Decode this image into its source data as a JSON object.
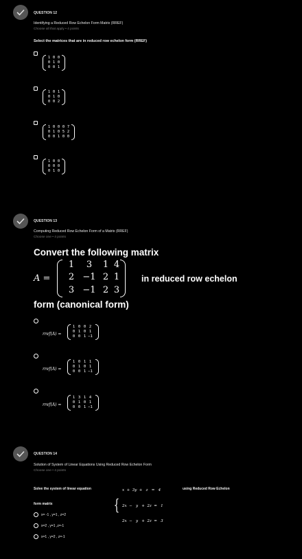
{
  "q12": {
    "number": "QUESTION 12",
    "title": "Identifying a Reduced Row Echelon Form Matrix (RREF)",
    "sub": "Choose all that apply • 4 points",
    "prompt": "Select the matrices that are in reduced row echelon form (RREF)",
    "options": [
      {
        "rows": [
          [
            "1",
            "0",
            "0"
          ],
          [
            "0",
            "1",
            "0"
          ],
          [
            "0",
            "0",
            "1"
          ]
        ]
      },
      {
        "rows": [
          [
            "1",
            "0",
            "1"
          ],
          [
            "0",
            "1",
            "0"
          ],
          [
            "0",
            "0",
            "2"
          ]
        ]
      },
      {
        "rows": [
          [
            "1",
            "0",
            "0",
            "0",
            "7"
          ],
          [
            "0",
            "1",
            "0",
            "5",
            "2"
          ],
          [
            "0",
            "0",
            "1",
            "0",
            "0"
          ]
        ]
      },
      {
        "rows": [
          [
            "1",
            "0",
            "0"
          ],
          [
            "0",
            "0",
            "0"
          ],
          [
            "0",
            "1",
            "0"
          ]
        ]
      }
    ]
  },
  "q13": {
    "number": "QUESTION 13",
    "title": "Computing Reduced Row Echelon Form of a Matrix (RREF)",
    "sub": "Choose one • 4 points",
    "prompt_line1": "Convert the following matrix",
    "a_label": "A =",
    "matrix": [
      [
        "1",
        "3",
        "1",
        "4"
      ],
      [
        "2",
        "−1",
        "2",
        "1"
      ],
      [
        "3",
        "−1",
        "2",
        "3"
      ]
    ],
    "prompt_line2": "in reduced row echelon",
    "prompt_line3": "form (canonical form)",
    "rref_label": "rref(A) =",
    "options": [
      {
        "rows": [
          [
            "1",
            "0",
            "0",
            "2"
          ],
          [
            "0",
            "1",
            "0",
            "1"
          ],
          [
            "0",
            "0",
            "1",
            "−1"
          ]
        ]
      },
      {
        "rows": [
          [
            "1",
            "0",
            "1",
            "1"
          ],
          [
            "0",
            "1",
            "0",
            "1"
          ],
          [
            "0",
            "0",
            "1",
            "−1"
          ]
        ]
      },
      {
        "rows": [
          [
            "1",
            "3",
            "1",
            "4"
          ],
          [
            "0",
            "1",
            "0",
            "1"
          ],
          [
            "0",
            "0",
            "1",
            "−1"
          ]
        ]
      }
    ]
  },
  "q14": {
    "number": "QUESTION 14",
    "title": "Solution of System of Linear Equations Using Reduced Row Echelon Form",
    "sub": "Choose one • 4 points",
    "prompt_a": "Solve the system of linear equation",
    "system": [
      "x  +  3y  +   z   =   4",
      "2x  −   y   +  2z  =   1",
      "2x  −   y   +  2z  =   3"
    ],
    "prompt_b": "using Reduced Row Echelon",
    "prompt_c": "form matrix",
    "options": [
      "x= -1 , y=1 , z=2",
      "x=2 , y=1 ,z=-1",
      "x=1 , y=2 , z=-1"
    ]
  }
}
